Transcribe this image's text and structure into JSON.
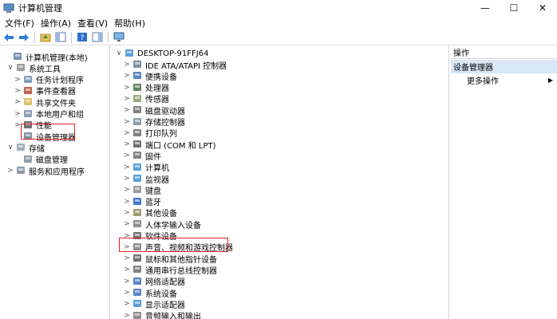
{
  "window": {
    "title": "计算机管理",
    "minimize": "—",
    "maximize": "☐",
    "close": "✕"
  },
  "menu": [
    "文件(F)",
    "操作(A)",
    "查看(V)",
    "帮助(H)"
  ],
  "left_tree": [
    {
      "label": "计算机管理(本地)",
      "level": 0,
      "tw": "",
      "icon": "computer-icon",
      "color": "#5b7fa8"
    },
    {
      "label": "系统工具",
      "level": 1,
      "tw": "∨",
      "icon": "tools-icon",
      "color": "#8b8b8b"
    },
    {
      "label": "任务计划程序",
      "level": 2,
      "tw": ">",
      "icon": "clock-icon",
      "color": "#6a8fb5"
    },
    {
      "label": "事件查看器",
      "level": 2,
      "tw": ">",
      "icon": "event-viewer-icon",
      "color": "#b5482f"
    },
    {
      "label": "共享文件夹",
      "level": 2,
      "tw": ">",
      "icon": "shared-folder-icon",
      "color": "#d9b44a"
    },
    {
      "label": "本地用户和组",
      "level": 2,
      "tw": ">",
      "icon": "users-icon",
      "color": "#7a8fa8"
    },
    {
      "label": "性能",
      "level": 2,
      "tw": ">",
      "icon": "performance-icon",
      "color": "#555555"
    },
    {
      "label": "设备管理器",
      "level": 2,
      "tw": "",
      "icon": "device-manager-icon",
      "color": "#6b7b8b"
    },
    {
      "label": "存储",
      "level": 1,
      "tw": "∨",
      "icon": "storage-icon",
      "color": "#8b9bab"
    },
    {
      "label": "磁盘管理",
      "level": 2,
      "tw": "",
      "icon": "disk-icon",
      "color": "#7b8b9b"
    },
    {
      "label": "服务和应用程序",
      "level": 1,
      "tw": ">",
      "icon": "services-icon",
      "color": "#7b8b9b"
    }
  ],
  "device_root": {
    "label": "DESKTOP-91FFJ64",
    "tw": "∨"
  },
  "devices": [
    {
      "label": "IDE ATA/ATAPI 控制器",
      "icon": "ide-controller-icon",
      "color": "#6b7b8b"
    },
    {
      "label": "便携设备",
      "icon": "portable-device-icon",
      "color": "#3d6fb4"
    },
    {
      "label": "处理器",
      "icon": "processor-icon",
      "color": "#4a6a4a"
    },
    {
      "label": "传感器",
      "icon": "sensor-icon",
      "color": "#8a9a6a"
    },
    {
      "label": "磁盘驱动器",
      "icon": "disk-drive-icon",
      "color": "#6b6b6b"
    },
    {
      "label": "存储控制器",
      "icon": "storage-controller-icon",
      "color": "#7b8b9b"
    },
    {
      "label": "打印队列",
      "icon": "printer-icon",
      "color": "#6b6b6b"
    },
    {
      "label": "端口 (COM 和 LPT)",
      "icon": "port-icon",
      "color": "#5b5b5b"
    },
    {
      "label": "固件",
      "icon": "firmware-icon",
      "color": "#6b6b6b"
    },
    {
      "label": "计算机",
      "icon": "computer-icon",
      "color": "#3d8fd4"
    },
    {
      "label": "监视器",
      "icon": "monitor-icon",
      "color": "#3d8fd4"
    },
    {
      "label": "键盘",
      "icon": "keyboard-icon",
      "color": "#8b8b8b"
    },
    {
      "label": "蓝牙",
      "icon": "bluetooth-icon",
      "color": "#1f5fbf"
    },
    {
      "label": "其他设备",
      "icon": "other-devices-icon",
      "color": "#8b8b5b"
    },
    {
      "label": "人体学输入设备",
      "icon": "hid-icon",
      "color": "#7b7b7b"
    },
    {
      "label": "软件设备",
      "icon": "software-device-icon",
      "color": "#5b5b5b"
    },
    {
      "label": "声音、视频和游戏控制器",
      "icon": "sound-icon",
      "color": "#7b7b7b"
    },
    {
      "label": "鼠标和其他指针设备",
      "icon": "mouse-icon",
      "color": "#5b5b5b"
    },
    {
      "label": "通用串行总线控制器",
      "icon": "usb-icon",
      "color": "#6b6b6b"
    },
    {
      "label": "网络适配器",
      "icon": "network-adapter-icon",
      "color": "#3d6fb4"
    },
    {
      "label": "系统设备",
      "icon": "system-device-icon",
      "color": "#3d6fb4"
    },
    {
      "label": "显示适配器",
      "icon": "display-adapter-icon",
      "color": "#3d8fd4"
    },
    {
      "label": "音频输入和输出",
      "icon": "audio-io-icon",
      "color": "#7b7b7b"
    }
  ],
  "actions": {
    "header": "操作",
    "section": "设备管理器",
    "more": "更多操作",
    "arrow": "▶"
  }
}
